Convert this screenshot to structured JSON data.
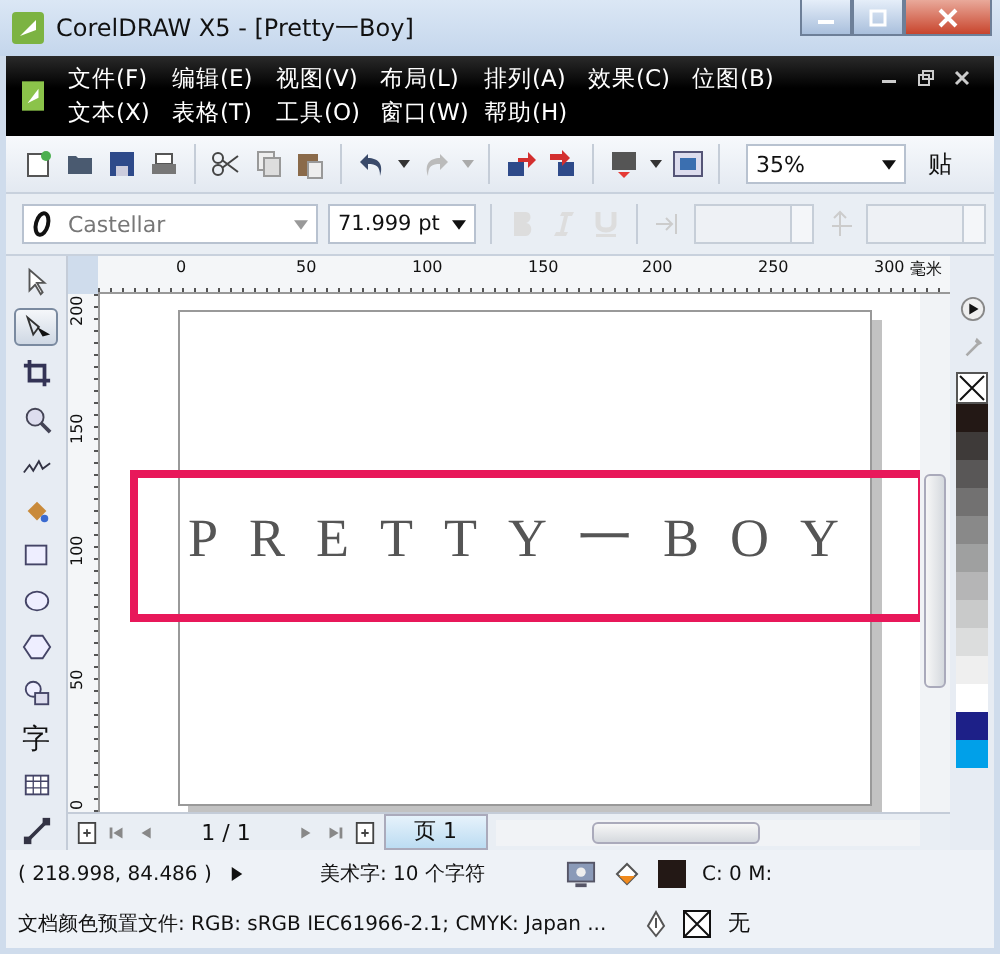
{
  "window": {
    "title": "CorelDRAW X5 - [Pretty一Boy]"
  },
  "menu_rows": [
    [
      {
        "label": "文件(F)"
      },
      {
        "label": "编辑(E)"
      },
      {
        "label": "视图(V)"
      },
      {
        "label": "布局(L)"
      },
      {
        "label": "排列(A)"
      },
      {
        "label": "效果(C)"
      },
      {
        "label": "位图(B)"
      }
    ],
    [
      {
        "label": "文本(X)"
      },
      {
        "label": "表格(T)"
      },
      {
        "label": "工具(O)"
      },
      {
        "label": "窗口(W)"
      },
      {
        "label": "帮助(H)"
      }
    ]
  ],
  "toolbar": {
    "zoom": "35%",
    "cut_label": "贴"
  },
  "property_bar": {
    "font": "Castellar",
    "font_size": "71.999 pt"
  },
  "toolbox": [
    {
      "kind": "pointer",
      "selected": false
    },
    {
      "kind": "shape",
      "selected": true
    },
    {
      "kind": "crop",
      "selected": false
    },
    {
      "kind": "zoom",
      "selected": false
    },
    {
      "kind": "freehand",
      "selected": false
    },
    {
      "kind": "fill",
      "selected": false
    },
    {
      "kind": "rectangle",
      "selected": false
    },
    {
      "kind": "ellipse",
      "selected": false
    },
    {
      "kind": "polygon",
      "selected": false
    },
    {
      "kind": "shapes",
      "selected": false
    },
    {
      "kind": "text",
      "glyph": "字",
      "selected": false
    },
    {
      "kind": "table",
      "selected": false
    },
    {
      "kind": "dimension",
      "selected": false
    }
  ],
  "rulers": {
    "unit": "毫米",
    "horizontal": [
      "0",
      "50",
      "100",
      "150",
      "200",
      "250",
      "300"
    ],
    "vertical": [
      "200",
      "150",
      "100",
      "50",
      "0"
    ]
  },
  "canvas": {
    "text": "PRETTY一BOY",
    "highlight": true
  },
  "page_nav": {
    "counter": "1 / 1",
    "tabs": [
      {
        "label": "页 1",
        "selected": true
      }
    ]
  },
  "palette": [
    {
      "color": "#231815"
    },
    {
      "color": "#3e3a39"
    },
    {
      "color": "#595757"
    },
    {
      "color": "#727171"
    },
    {
      "color": "#898989"
    },
    {
      "color": "#9fa0a0"
    },
    {
      "color": "#b5b5b6"
    },
    {
      "color": "#c9caca"
    },
    {
      "color": "#dcdddd"
    },
    {
      "color": "#efefef"
    },
    {
      "color": "#ffffff"
    },
    {
      "color": "#1d2088"
    },
    {
      "color": "#00a0e9"
    }
  ],
  "status": {
    "coordinates": "( 218.998, 84.486 )",
    "object_info": "美术字: 10 个字符",
    "fill_swatch": {
      "color": "#231815"
    },
    "fill_info": "C: 0 M:",
    "color_profile": "文档颜色预置文件: RGB: sRGB IEC61966-2.1; CMYK: Japan ...",
    "outline_info": "无"
  }
}
